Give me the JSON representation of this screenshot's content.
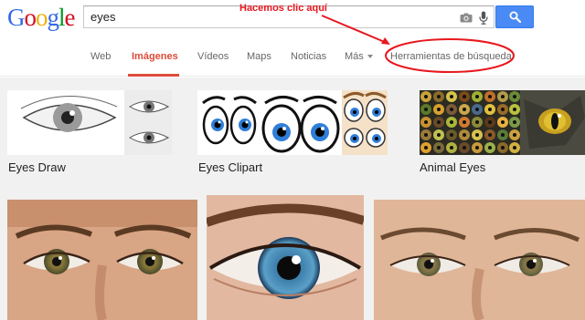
{
  "header": {
    "logo_letters": [
      {
        "char": "G",
        "color": "#3369e8"
      },
      {
        "char": "o",
        "color": "#d50f25"
      },
      {
        "char": "o",
        "color": "#eeb211"
      },
      {
        "char": "g",
        "color": "#3369e8"
      },
      {
        "char": "l",
        "color": "#009925"
      },
      {
        "char": "e",
        "color": "#d50f25"
      }
    ],
    "search_value": "eyes",
    "camera_icon": "camera-icon",
    "mic_icon": "mic-icon",
    "search_button_icon": "search-icon"
  },
  "tabs": [
    {
      "label": "Web",
      "active": false
    },
    {
      "label": "Imágenes",
      "active": true
    },
    {
      "label": "Vídeos",
      "active": false
    },
    {
      "label": "Maps",
      "active": false
    },
    {
      "label": "Noticias",
      "active": false
    },
    {
      "label": "Más",
      "active": false
    },
    {
      "label": "Herramientas de búsqueda",
      "active": false
    }
  ],
  "annotation": {
    "text": "Hacemos clic aquí",
    "color": "#e8181f"
  },
  "related_searches": [
    {
      "label": "Eyes Draw"
    },
    {
      "label": "Eyes Clipart"
    },
    {
      "label": "Animal Eyes"
    }
  ],
  "image_results_count": 3,
  "colors": {
    "accent": "#dd4b39",
    "search_button": "#4a8af4",
    "background": "#f1f1f1"
  }
}
